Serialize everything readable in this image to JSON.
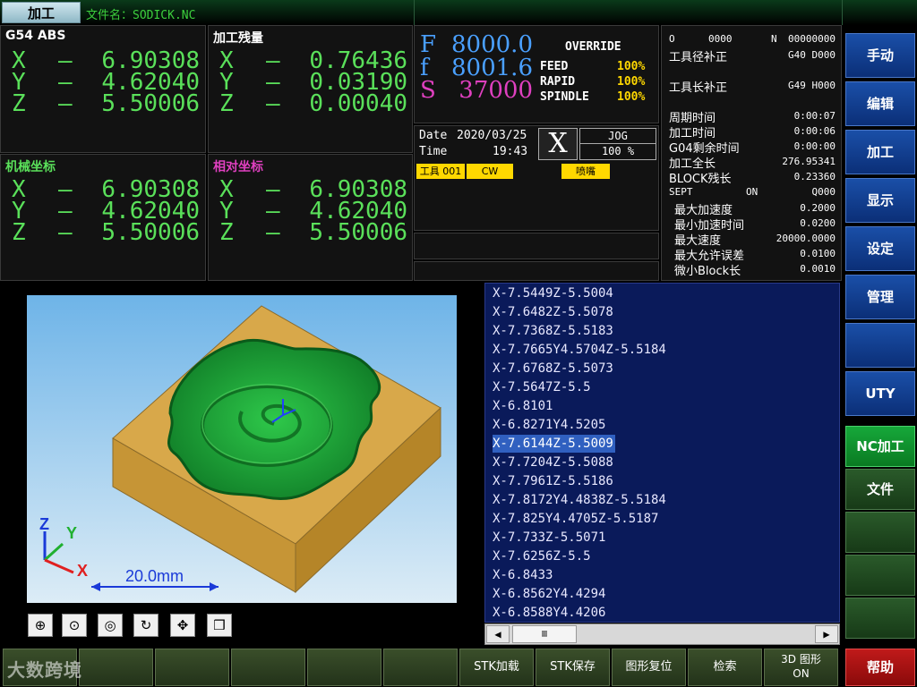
{
  "titlebar": {
    "mode_tab": "加工",
    "file_label": "文件名：SODICK.NC"
  },
  "g54": {
    "title": "G54 ABS",
    "rows": [
      {
        "axis": "X",
        "sign": "—",
        "value": "6.90308"
      },
      {
        "axis": "Y",
        "sign": "—",
        "value": "4.62040"
      },
      {
        "axis": "Z",
        "sign": "—",
        "value": "5.50006"
      }
    ]
  },
  "remaining": {
    "title": "加工残量",
    "rows": [
      {
        "axis": "X",
        "sign": "—",
        "value": "0.76436"
      },
      {
        "axis": "Y",
        "sign": "—",
        "value": "0.03190"
      },
      {
        "axis": "Z",
        "sign": "—",
        "value": "0.00040"
      }
    ]
  },
  "machine": {
    "title": "机械坐标",
    "rows": [
      {
        "axis": "X",
        "sign": "—",
        "value": "6.90308"
      },
      {
        "axis": "Y",
        "sign": "—",
        "value": "4.62040"
      },
      {
        "axis": "Z",
        "sign": "—",
        "value": "5.50006"
      }
    ]
  },
  "relative": {
    "title": "相对坐标",
    "rows": [
      {
        "axis": "X",
        "sign": "—",
        "value": "6.90308"
      },
      {
        "axis": "Y",
        "sign": "—",
        "value": "4.62040"
      },
      {
        "axis": "Z",
        "sign": "—",
        "value": "5.50006"
      }
    ]
  },
  "feed": {
    "F": {
      "label": "F",
      "value": "8000.0"
    },
    "f": {
      "label": "f",
      "value": "8001.6"
    },
    "S": {
      "label": "S",
      "value": "37000"
    },
    "override_title": "OVERRIDE",
    "overrides": [
      {
        "name": "FEED",
        "value": "100%"
      },
      {
        "name": "RAPID",
        "value": "100%"
      },
      {
        "name": "SPINDLE",
        "value": "100%"
      }
    ]
  },
  "datetime": {
    "date_label": "Date",
    "date": "2020/03/25",
    "time_label": "Time",
    "time": "19:43",
    "axis": "X",
    "jog": "JOG",
    "jog_pct": "100 %",
    "tool_tag": "工具 001",
    "cw_tag": "CW",
    "nozzle_tag": "喷嘴"
  },
  "info": {
    "o_label": "O",
    "o_value": "0000",
    "n_label": "N",
    "n_value": "00000000",
    "tool_radius": "工具径补正",
    "tool_radius_val": "G40 D000",
    "tool_length": "工具长补正",
    "tool_length_val": "G49 H000",
    "rows": [
      {
        "label": "周期时间",
        "value": "0:00:07"
      },
      {
        "label": "加工时间",
        "value": "0:00:06"
      },
      {
        "label": "G04剩余时间",
        "value": "0:00:00"
      },
      {
        "label": "加工全长",
        "value": "276.95341"
      },
      {
        "label": "BLOCK残长",
        "value": "0.23360"
      }
    ],
    "sept_label": "SEPT",
    "sept_on": "ON",
    "sept_value": "Q000",
    "sept_rows": [
      {
        "label": "最大加速度",
        "value": "0.2000"
      },
      {
        "label": "最小加速时间",
        "value": "0.0200"
      },
      {
        "label": "最大速度",
        "value": "20000.0000"
      },
      {
        "label": "最大允许误差",
        "value": "0.0100"
      },
      {
        "label": "微小Block长",
        "value": "0.0010"
      }
    ]
  },
  "side_buttons": [
    {
      "label": "手动",
      "style": "blue"
    },
    {
      "label": "编辑",
      "style": "blue"
    },
    {
      "label": "加工",
      "style": "blue"
    },
    {
      "label": "显示",
      "style": "blue"
    },
    {
      "label": "设定",
      "style": "blue"
    },
    {
      "label": "管理",
      "style": "blue"
    },
    {
      "label": "",
      "style": "blue"
    },
    {
      "label": "UTY",
      "style": "blue"
    },
    {
      "label": "NC加工",
      "style": "green-active"
    },
    {
      "label": "文件",
      "style": "green"
    },
    {
      "label": "",
      "style": "green"
    },
    {
      "label": "",
      "style": "green"
    },
    {
      "label": "",
      "style": "green"
    },
    {
      "label": "帮助",
      "style": "red"
    }
  ],
  "graphic": {
    "scale_label": "20.0mm",
    "axis_x": "X",
    "axis_y": "Y",
    "axis_z": "Z"
  },
  "graphic_tools": [
    "zoom-fit",
    "zoom-in",
    "zoom-area",
    "rotate",
    "pan",
    "view-3d"
  ],
  "program_lines": [
    "X-7.5449Z-5.5004",
    "X-7.6482Z-5.5078",
    "X-7.7368Z-5.5183",
    "X-7.7665Y4.5704Z-5.5184",
    "X-7.6768Z-5.5073",
    "X-7.5647Z-5.5",
    "X-6.8101",
    "X-6.8271Y4.5205",
    "X-7.6144Z-5.5009",
    "X-7.7204Z-5.5088",
    "X-7.7961Z-5.5186",
    "X-7.8172Y4.4838Z-5.5184",
    "X-7.825Y4.4705Z-5.5187",
    "X-7.733Z-5.5071",
    "X-7.6256Z-5.5",
    "X-6.8433",
    "X-6.8562Y4.4294",
    "X-6.8588Y4.4206"
  ],
  "selected_line": 8,
  "scrollbar": {
    "left": "◀",
    "right": "▶",
    "thumb": "▥"
  },
  "bottom_buttons": [
    {
      "label": ""
    },
    {
      "label": ""
    },
    {
      "label": ""
    },
    {
      "label": ""
    },
    {
      "label": ""
    },
    {
      "label": ""
    },
    {
      "label": "STK加载"
    },
    {
      "label": "STK保存"
    },
    {
      "label": "图形复位"
    },
    {
      "label": "检索"
    },
    {
      "label": "3D 图形",
      "sub": "ON"
    }
  ],
  "watermark": "大数跨境",
  "colors": {
    "axis_green": "#5ae05a",
    "accent_blue": "#1a4fa8",
    "tag_yellow": "#ffd800",
    "program_bg": "#0a1a5a"
  }
}
